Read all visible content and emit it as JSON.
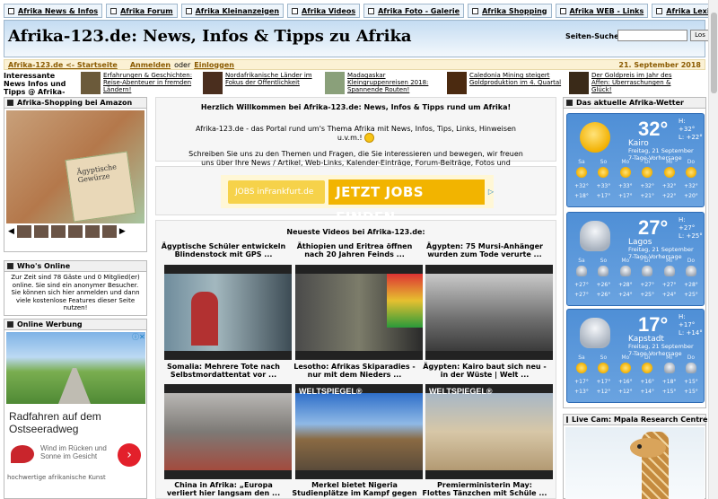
{
  "topnav": [
    {
      "label": "Afrika News & Infos"
    },
    {
      "label": "Afrika Forum"
    },
    {
      "label": "Afrika Kleinanzeigen"
    },
    {
      "label": "Afrika Videos"
    },
    {
      "label": "Afrika Foto - Galerie"
    },
    {
      "label": "Afrika Shopping"
    },
    {
      "label": "Afrika WEB - Links"
    },
    {
      "label": "Afrika Lexikon"
    }
  ],
  "header": {
    "title": "Afrika-123.de: News, Infos & Tipps zu Afrika",
    "search_label": "Seiten-Suche:",
    "search_value": "",
    "login_label": "Los"
  },
  "crumb": {
    "home": "Afrika-123.de <- Startseite",
    "login": "Anmelden",
    "or": "oder",
    "register": "Einloggen",
    "date": "21. September 2018"
  },
  "news": {
    "heading": "Interessante News Infos und Tipps @ Afrika-123.de:",
    "items": [
      {
        "text": "Erfahrungen & Geschichten: Reise-Abenteuer in fremden Ländern!"
      },
      {
        "text": "Nordafrikanische Länder im Fokus der Öffentlichkeit"
      },
      {
        "text": "Madagaskar Kleingruppenreisen 2018: Spannende Routen!"
      },
      {
        "text": "Caledonia Mining steigert Goldproduktion im 4. Quartal"
      },
      {
        "text": "Der Goldpreis im Jahr des Affen: Überraschungen & Glück!"
      }
    ]
  },
  "amazon": {
    "heading": "Afrika-Shopping bei Amazon",
    "pack_label": "Ägyptische Gewürze"
  },
  "who": {
    "heading": "Who's Online",
    "text": "Zur Zeit sind 78 Gäste und 0 Mitglied(er) online. Sie sind ein anonymer Besucher. Sie können sich hier anmelden und dann viele kostenlose Features dieser Seite nutzen!"
  },
  "werbung": {
    "heading": "Online Werbung",
    "ad_title": "Radfahren auf dem Ostseeradweg",
    "ad_sub": "Wind im Rücken und Sonne im Gesicht",
    "ad_btn": "›",
    "ad_x": "ⓘ✕",
    "img_alt": "hochwertige afrikanische Kunst"
  },
  "welcome": {
    "title": "Herzlich Willkommen bei Afrika-123.de: News, Infos & Tipps rund um Afrika!",
    "p1": "Afrika-123.de - das Portal rund um's Thema Afrika mit News, Infos, Tips, Links, Hinweisen u.v.m.!",
    "p2": "Schreiben Sie uns zu den Themen und Fragen, die Sie interessieren und bewegen, wir freuen uns über Ihre News / Artikel, Web-Links, Kalender-Einträge, Forum-Beiträge, Fotos und Kleinanzeigen!"
  },
  "jobs": {
    "logo": "JOBS inFrankfurt.de",
    "cta": "JETZT JOBS FINDEN."
  },
  "videos": {
    "title": "Neueste Videos bei Afrika-123.de:",
    "items": [
      {
        "title": "Ägyptische Schüler entwickeln Blindenstock mit GPS ..."
      },
      {
        "title": "Äthiopien und Eritrea öffnen nach 20 Jahren Feinds ..."
      },
      {
        "title": "Ägypten: 75 Mursi-Anhänger wurden zum Tode verurte ..."
      },
      {
        "title": "Somalia: Mehrere Tote nach Selbstmordattentat vor ..."
      },
      {
        "title": "Lesotho: Afrikas Skiparadies - nur mit dem Nieders ..."
      },
      {
        "title": "Ägypten: Kairo baut sich neu - in der Wüste | Welt ..."
      },
      {
        "title": "China in Afrika: „Europa verliert hier langsam den ..."
      },
      {
        "title": "Merkel bietet Nigeria Studienplätze im Kampf gegen ..."
      },
      {
        "title": "Premierministerin May: Flottes Tänzchen mit Schüle ..."
      }
    ],
    "ws_label": "WELTSPIEGEL®"
  },
  "weather": {
    "heading": "Das aktuelle Afrika-Wetter",
    "days": [
      "Sa",
      "So",
      "Mo",
      "Di",
      "Mi",
      "Do"
    ],
    "cities": [
      {
        "temp": "32°",
        "h": "H: +32°",
        "l": "L: +22°",
        "city": "Kairo",
        "date": "Freitag, 21 September",
        "fc": "7-Tage-Vorhersage",
        "icon": "sun",
        "hi": [
          "+32°",
          "+33°",
          "+33°",
          "+32°",
          "+32°",
          "+32°"
        ],
        "lo": [
          "+18°",
          "+17°",
          "+17°",
          "+21°",
          "+22°",
          "+20°"
        ],
        "icons": [
          "sun",
          "sun",
          "sun",
          "sun",
          "sun",
          "sun"
        ]
      },
      {
        "temp": "27°",
        "h": "H: +27°",
        "l": "L: +25°",
        "city": "Lagos",
        "date": "Freitag, 21 September",
        "fc": "7-Tage-Vorhersage",
        "icon": "cloud",
        "hi": [
          "+27°",
          "+26°",
          "+28°",
          "+27°",
          "+27°",
          "+28°"
        ],
        "lo": [
          "+27°",
          "+26°",
          "+24°",
          "+25°",
          "+24°",
          "+25°"
        ],
        "icons": [
          "cloud",
          "cloud",
          "cloud",
          "cloud",
          "cloud",
          "cloud"
        ]
      },
      {
        "temp": "17°",
        "h": "H: +17°",
        "l": "L: +14°",
        "city": "Kapstadt",
        "date": "Freitag, 21 September",
        "fc": "7-Tage-Vorhersage",
        "icon": "cloud",
        "hi": [
          "+17°",
          "+17°",
          "+16°",
          "+16°",
          "+18°",
          "+15°"
        ],
        "lo": [
          "+13°",
          "+12°",
          "+12°",
          "+14°",
          "+15°",
          "+15°"
        ],
        "icons": [
          "sun",
          "sun",
          "sun",
          "sun",
          "cloud",
          "cloud"
        ]
      }
    ]
  },
  "cam": {
    "heading": "Live Cam: Mpala Research Centre"
  }
}
